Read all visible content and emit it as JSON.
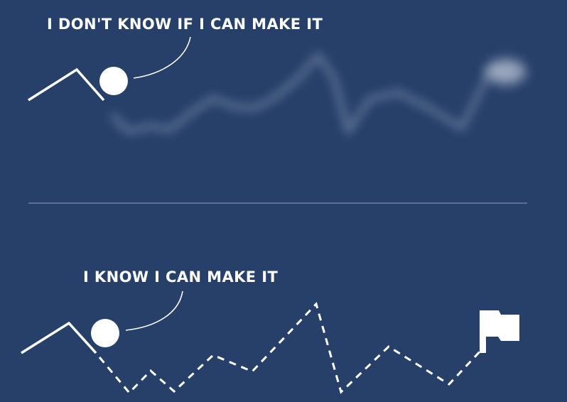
{
  "top_panel": {
    "caption": "I DON'T KNOW IF I CAN MAKE IT",
    "path_style": "blurred, faded",
    "goal_style": "blurred cloud"
  },
  "bottom_panel": {
    "caption": "I KNOW I CAN MAKE IT",
    "path_style": "dashed, clear",
    "goal_icon": "flag-icon"
  },
  "colors": {
    "background": "#27406a",
    "foreground": "#ffffff"
  }
}
